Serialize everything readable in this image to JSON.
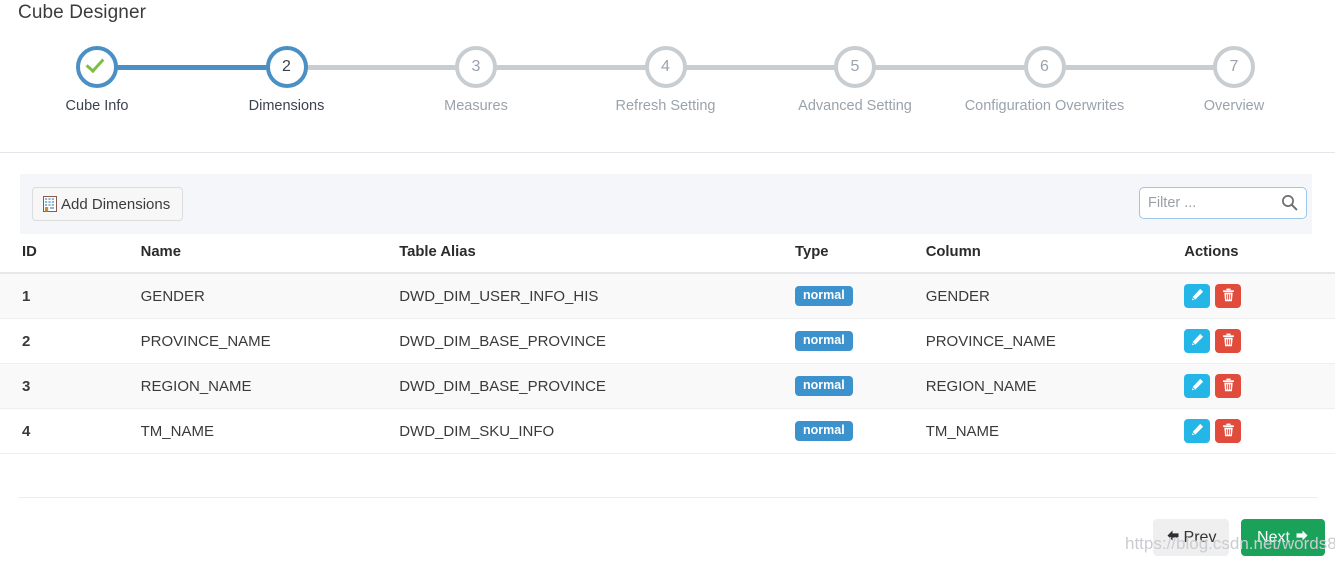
{
  "page": {
    "title": "Cube Designer",
    "watermark": "https://blog.csdn.net/words8"
  },
  "stepper": {
    "steps": [
      {
        "num": "✓",
        "label": "Cube Info",
        "state": "done"
      },
      {
        "num": "2",
        "label": "Dimensions",
        "state": "active"
      },
      {
        "num": "3",
        "label": "Measures",
        "state": "pending"
      },
      {
        "num": "4",
        "label": "Refresh Setting",
        "state": "pending"
      },
      {
        "num": "5",
        "label": "Advanced Setting",
        "state": "pending"
      },
      {
        "num": "6",
        "label": "Configuration Overwrites",
        "state": "pending"
      },
      {
        "num": "7",
        "label": "Overview",
        "state": "pending"
      }
    ],
    "accent_color": "#4a90c4",
    "pending_color": "#c8cdd2",
    "check_color": "#7cc043"
  },
  "toolbar": {
    "add_label": "Add Dimensions",
    "add_icon": "building-icon",
    "filter_value": "",
    "filter_placeholder": "Filter ...",
    "search_icon": "search-icon"
  },
  "table": {
    "columns": [
      "ID",
      "Name",
      "Table Alias",
      "Type",
      "Column",
      "Actions"
    ],
    "rows": [
      {
        "id": "1",
        "name": "GENDER",
        "alias": "DWD_DIM_USER_INFO_HIS",
        "type": "normal",
        "column": "GENDER"
      },
      {
        "id": "2",
        "name": "PROVINCE_NAME",
        "alias": "DWD_DIM_BASE_PROVINCE",
        "type": "normal",
        "column": "PROVINCE_NAME"
      },
      {
        "id": "3",
        "name": "REGION_NAME",
        "alias": "DWD_DIM_BASE_PROVINCE",
        "type": "normal",
        "column": "REGION_NAME"
      },
      {
        "id": "4",
        "name": "TM_NAME",
        "alias": "DWD_DIM_SKU_INFO",
        "type": "normal",
        "column": "TM_NAME"
      }
    ],
    "badge_color": "#3c92cd",
    "edit_icon": "pencil-icon",
    "delete_icon": "trash-icon",
    "edit_color": "#25b6e8",
    "delete_color": "#e04b3c"
  },
  "footer": {
    "prev_label": "Prev",
    "next_label": "Next",
    "prev_icon": "arrow-left-icon",
    "next_icon": "arrow-right-icon",
    "next_color": "#1aa25a"
  }
}
